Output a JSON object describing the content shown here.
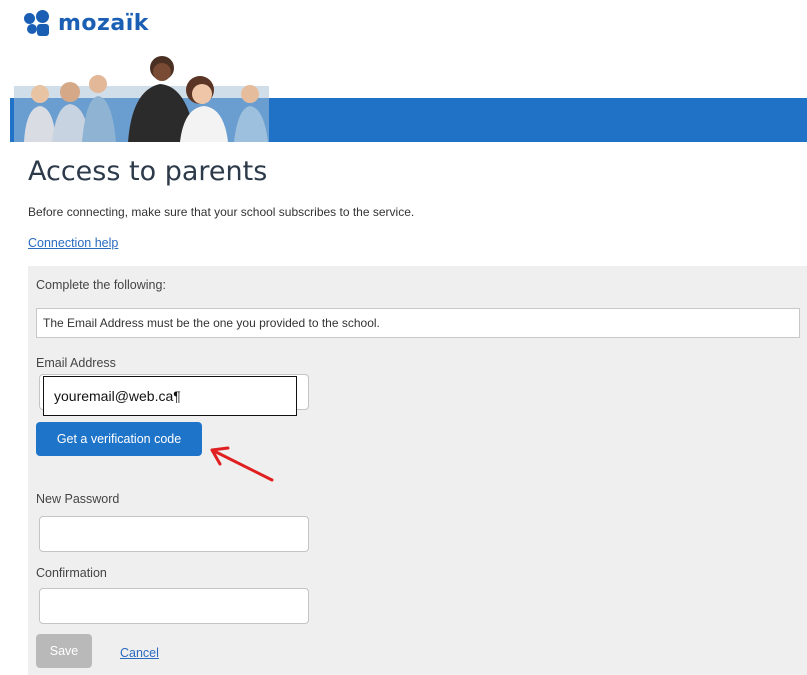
{
  "brand": {
    "name": "mozaïk",
    "color": "#1a5fb4"
  },
  "banner": {
    "bar_color": "#1f72c6",
    "image": "family-photo"
  },
  "page": {
    "title": "Access to parents",
    "intro": "Before connecting, make sure that your school subscribes to the service.",
    "help_link": "Connection help"
  },
  "form": {
    "instruction": "Complete the following:",
    "notice": "The Email Address must be the one you provided to the school.",
    "email": {
      "label": "Email Address",
      "value": "youremail@web.ca¶"
    },
    "verify_button": "Get a verification code",
    "new_password": {
      "label": "New Password",
      "value": ""
    },
    "confirmation": {
      "label": "Confirmation",
      "value": ""
    },
    "save_button": "Save",
    "cancel_link": "Cancel"
  },
  "annotation": {
    "type": "arrow",
    "color": "#e02020",
    "points_to": "verify_button"
  }
}
